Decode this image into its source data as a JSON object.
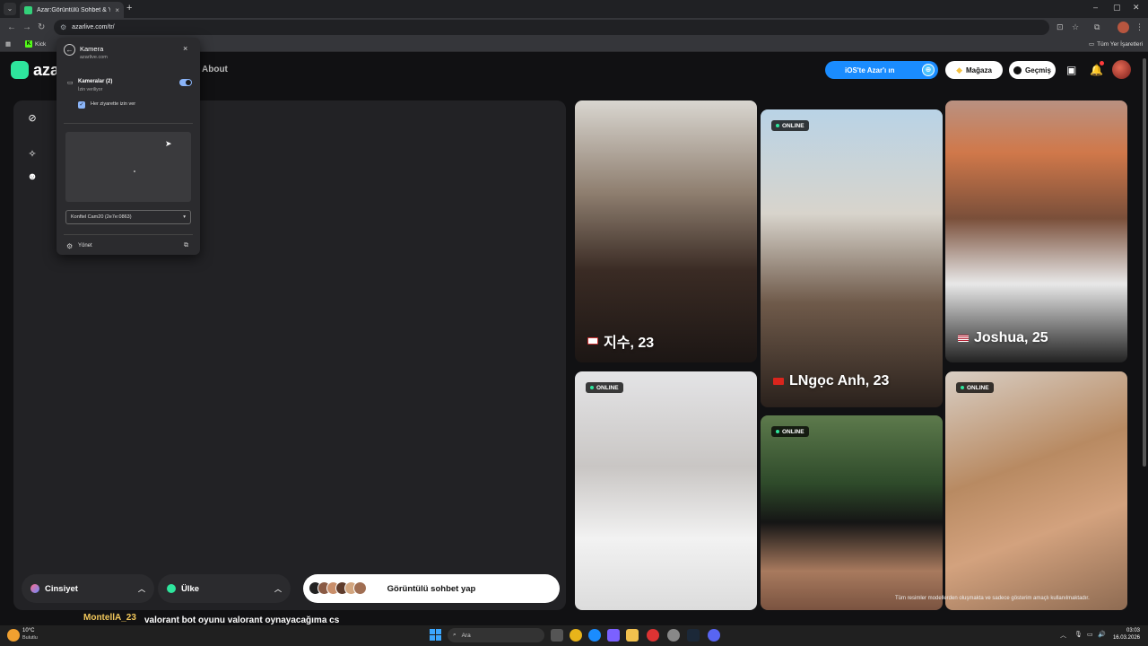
{
  "browser": {
    "tab_title": "Azar:Görüntülü Sohbet & Yeni",
    "tab_close": "×",
    "new_tab": "+",
    "url": "azarlive.com/tr/",
    "bookmark_kick": "Kick",
    "bookmark_all": "Tüm Yer İşaretleri",
    "win_min": "–",
    "win_max": "▢",
    "win_close": "✕"
  },
  "site": {
    "logo_text": "azar",
    "about": "About",
    "ios_button": "iOS'te Azar'ı ın",
    "store_button": "Mağaza",
    "history_button": "Geçmiş"
  },
  "filters": {
    "gender": "Cinsiyet",
    "country": "Ülke",
    "video_chat": "Görüntülü sohbet yap"
  },
  "profiles": [
    {
      "name": "지수, 23",
      "online": false
    },
    {
      "name": "LNgọc Anh, 23",
      "online": true,
      "badge": "ONLINE"
    },
    {
      "name": "Joshua, 25",
      "online": false
    },
    {
      "badge": "ONLINE"
    },
    {
      "badge": "ONLINE"
    },
    {
      "badge": "ONLINE"
    }
  ],
  "disclaimer": "Tüm resimler modellerden oluşmakta ve sadece gösterim amaçlı kullanılmaktadır.",
  "chat": {
    "user": "MontellA_23",
    "message": "valorant bot oyunu valorant oynayacağıma cs oynarım daha iyi"
  },
  "permission_popup": {
    "title": "Kamera",
    "site": "azarlive.com",
    "camera_label": "Kameralar (2)",
    "camera_status": "İzin veriliyor",
    "checkbox_label": "Her ziyarette izin ver",
    "checkbox_checked": true,
    "toggle_on": true,
    "selected_camera": "Konftel Cam20 (2e7e:0863)",
    "manage": "Yönet"
  },
  "taskbar": {
    "temperature": "10°C",
    "weather": "Bulutlu",
    "search_placeholder": "Ara",
    "time": "03:03",
    "date": "16.03.2026"
  },
  "colors": {
    "accent_green": "#2ee59d",
    "ios_blue": "#1a8cff",
    "chat_user": "#f1c75b"
  }
}
